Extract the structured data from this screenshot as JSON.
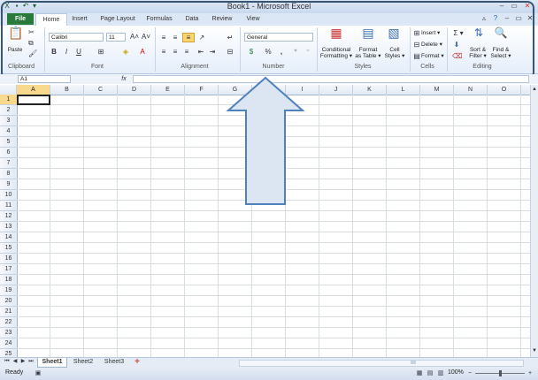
{
  "window": {
    "title": "Book1 - Microsoft Excel"
  },
  "tabs": [
    "File",
    "Home",
    "Insert",
    "Page Layout",
    "Formulas",
    "Data",
    "Review",
    "View"
  ],
  "clipboard": {
    "paste": "Paste",
    "label": "Clipboard"
  },
  "font": {
    "name": "Calibri",
    "size": "11",
    "label": "Font",
    "bold": "B",
    "italic": "I",
    "underline": "U",
    "grow": "A˄",
    "shrink": "A˅"
  },
  "alignment": {
    "label": "Alignment"
  },
  "number": {
    "format": "General",
    "label": "Number",
    "percent": "%",
    "comma": ","
  },
  "styles": {
    "conditional": [
      "Conditional",
      "Formatting ▾"
    ],
    "as_table": [
      "Format",
      "as Table ▾"
    ],
    "cell_styles": [
      "Cell",
      "Styles ▾"
    ],
    "label": "Styles"
  },
  "cells_group": {
    "insert": "Insert ▾",
    "delete": "Delete ▾",
    "format": "Format ▾",
    "label": "Cells"
  },
  "editing": {
    "sort": [
      "Sort &",
      "Filter ▾"
    ],
    "find": [
      "Find &",
      "Select ▾"
    ],
    "label": "Editing",
    "sigma": "Σ ▾"
  },
  "formula_bar": {
    "name_box": "A1",
    "fx": "fx"
  },
  "columns": [
    "A",
    "B",
    "C",
    "D",
    "E",
    "F",
    "G",
    "H",
    "I",
    "J",
    "K",
    "L",
    "M",
    "N",
    "O"
  ],
  "rows": [
    "1",
    "2",
    "3",
    "4",
    "5",
    "6",
    "7",
    "8",
    "9",
    "10",
    "11",
    "12",
    "13",
    "14",
    "15",
    "16",
    "17",
    "18",
    "19",
    "20",
    "21",
    "22",
    "23",
    "24",
    "25"
  ],
  "sheets": [
    "Sheet1",
    "Sheet2",
    "Sheet3"
  ],
  "status": {
    "ready": "Ready",
    "zoom": "100%",
    "minus": "−",
    "plus": "+"
  },
  "colors": {
    "file_tab": "#2a7b3b",
    "arrow_fill": "#dce6f2",
    "arrow_stroke": "#4f81bd",
    "frame": "#3a5574"
  }
}
